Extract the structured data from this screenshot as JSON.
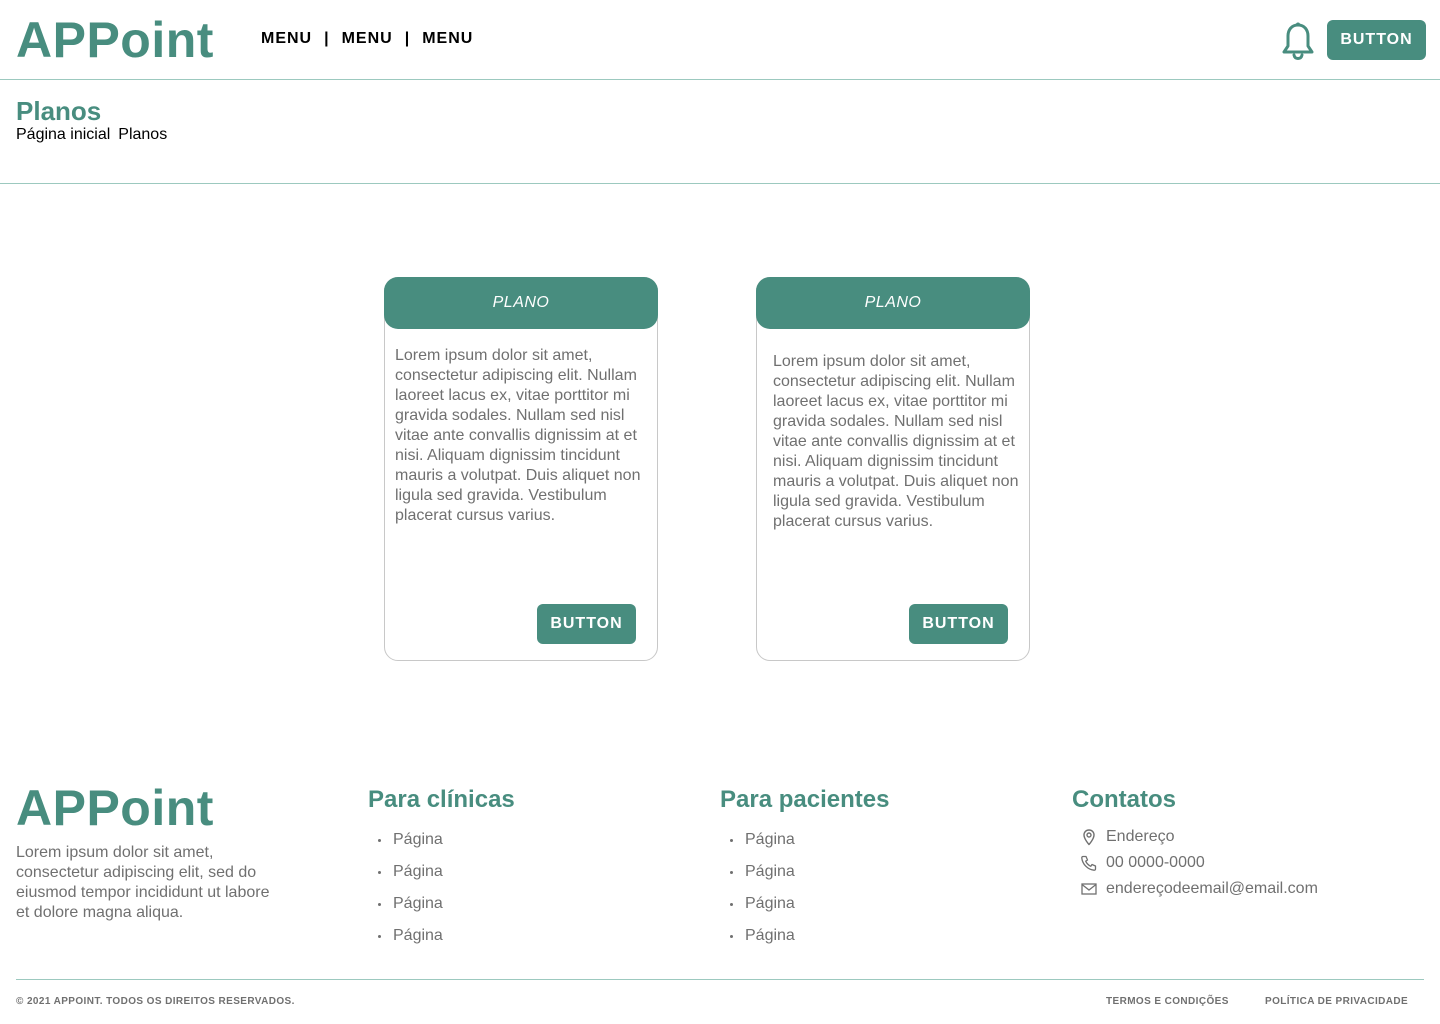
{
  "header": {
    "logo": "APPoint",
    "menu": [
      "MENU",
      "MENU",
      "MENU"
    ],
    "separator": "|",
    "button_label": "BUTTON"
  },
  "page": {
    "title": "Planos",
    "breadcrumb": [
      "Página inicial",
      "Planos"
    ]
  },
  "plans": [
    {
      "title": "PLANO",
      "description": "Lorem ipsum dolor sit amet, consectetur adipiscing elit. Nullam laoreet lacus ex, vitae porttitor mi gravida sodales. Nullam sed nisl vitae ante convallis dignissim at et nisi. Aliquam dignissim tincidunt mauris a volutpat. Duis aliquet non ligula sed gravida. Vestibulum placerat cursus varius.",
      "button_label": "BUTTON"
    },
    {
      "title": "PLANO",
      "description": "Lorem ipsum dolor sit amet, consectetur adipiscing elit. Nullam laoreet lacus ex, vitae porttitor mi gravida sodales. Nullam sed nisl vitae ante convallis dignissim at et nisi. Aliquam dignissim tincidunt mauris a volutpat. Duis aliquet non ligula sed gravida. Vestibulum placerat cursus varius.",
      "button_label": "BUTTON"
    }
  ],
  "footer": {
    "logo": "APPoint",
    "description": "Lorem ipsum dolor sit amet, consectetur adipiscing elit, sed do eiusmod tempor incididunt ut labore et dolore magna aliqua.",
    "clinics": {
      "title": "Para clínicas",
      "links": [
        "Página",
        "Página",
        "Página",
        "Página"
      ]
    },
    "patients": {
      "title": "Para pacientes",
      "links": [
        "Página",
        "Página",
        "Página",
        "Página"
      ]
    },
    "contacts": {
      "title": "Contatos",
      "address": "Endereço",
      "phone": "00 0000-0000",
      "email": "endereçodeemail@email.com"
    },
    "copyright": "© 2021 APPOINT. TODOS OS DIREITOS RESERVADOS.",
    "terms": "TERMOS E CONDIÇÕES",
    "privacy": "POLÍTICA DE PRIVACIDADE"
  },
  "colors": {
    "brand": "#488d7f",
    "divider": "#9cc9bf",
    "muted_text": "#707070"
  },
  "icons": [
    "bell-icon",
    "location-pin-icon",
    "phone-icon",
    "mail-icon"
  ]
}
